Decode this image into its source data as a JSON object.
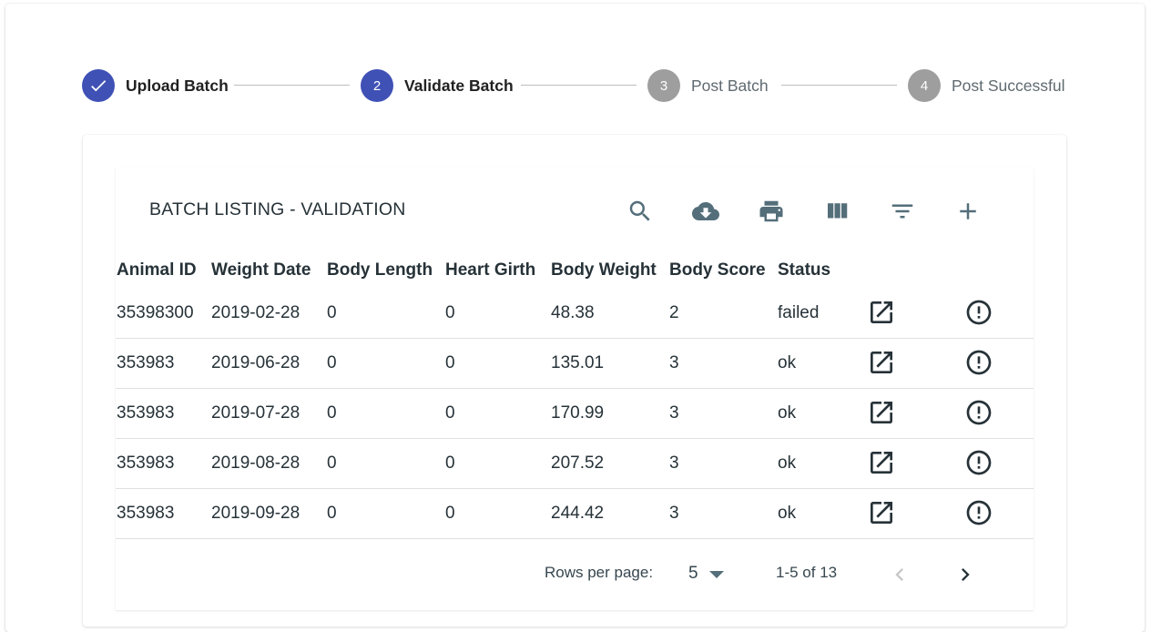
{
  "stepper": {
    "steps": [
      {
        "number": "",
        "label": "Upload Batch",
        "state": "done"
      },
      {
        "number": "2",
        "label": "Validate Batch",
        "state": "active"
      },
      {
        "number": "3",
        "label": "Post Batch",
        "state": "pending"
      },
      {
        "number": "4",
        "label": "Post Successful",
        "state": "pending"
      }
    ]
  },
  "table": {
    "title": "BATCH LISTING - VALIDATION",
    "toolbar_icons": [
      "search-icon",
      "cloud-download-icon",
      "print-icon",
      "view-column-icon",
      "filter-list-icon",
      "add-icon"
    ],
    "columns": [
      "Animal ID",
      "Weight Date",
      "Body Length",
      "Heart Girth",
      "Body Weight",
      "Body Score",
      "Status"
    ],
    "rows": [
      {
        "animal_id": "35398300",
        "weight_date": "2019-02-28",
        "body_length": "0",
        "heart_girth": "0",
        "body_weight": "48.38",
        "body_score": "2",
        "status": "failed"
      },
      {
        "animal_id": "353983",
        "weight_date": "2019-06-28",
        "body_length": "0",
        "heart_girth": "0",
        "body_weight": "135.01",
        "body_score": "3",
        "status": "ok"
      },
      {
        "animal_id": "353983",
        "weight_date": "2019-07-28",
        "body_length": "0",
        "heart_girth": "0",
        "body_weight": "170.99",
        "body_score": "3",
        "status": "ok"
      },
      {
        "animal_id": "353983",
        "weight_date": "2019-08-28",
        "body_length": "0",
        "heart_girth": "0",
        "body_weight": "207.52",
        "body_score": "3",
        "status": "ok"
      },
      {
        "animal_id": "353983",
        "weight_date": "2019-09-28",
        "body_length": "0",
        "heart_girth": "0",
        "body_weight": "244.42",
        "body_score": "3",
        "status": "ok"
      }
    ],
    "row_icons": [
      "open-in-new-icon",
      "error-outline-icon"
    ]
  },
  "pagination": {
    "rows_per_page_label": "Rows per page:",
    "rows_per_page_value": "5",
    "range_text": "1-5 of 13"
  },
  "colors": {
    "accent": "#3f51b5",
    "pending": "#9e9e9e",
    "icon": "#546e7a"
  }
}
